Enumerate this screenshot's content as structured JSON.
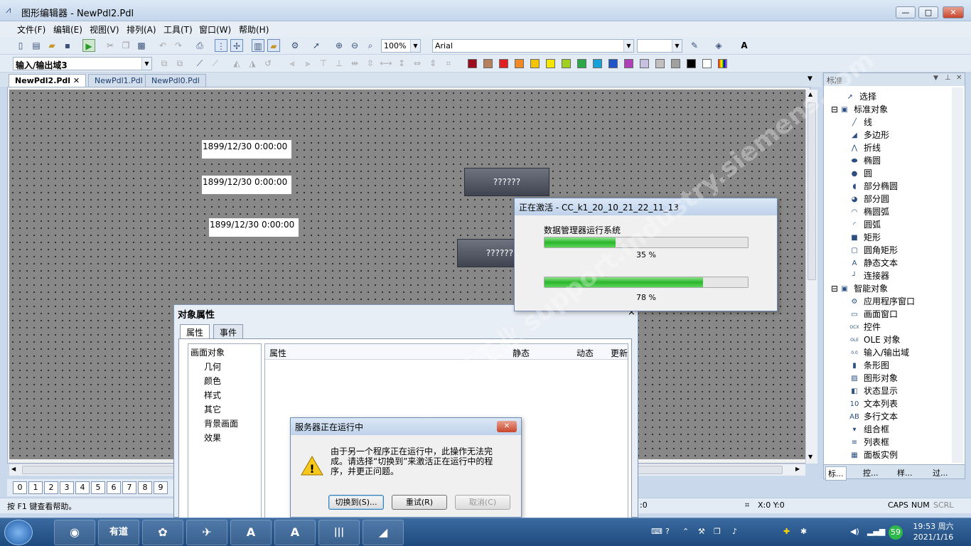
{
  "window": {
    "title": "图形编辑器 - NewPdl2.Pdl",
    "min": "—",
    "max": "□",
    "close": "✕"
  },
  "menu": [
    "文件(F)",
    "编辑(E)",
    "视图(V)",
    "排列(A)",
    "工具(T)",
    "窗口(W)",
    "帮助(H)"
  ],
  "toolbar1": {
    "zoom": "100%",
    "font": "Arial"
  },
  "toolbar2": {
    "object_select": "输入/输出域3"
  },
  "palette": [
    "#9b0e1e",
    "#b8815e",
    "#e02020",
    "#f08a24",
    "#f4c400",
    "#f4e600",
    "#a0d020",
    "#2aa84a",
    "#18a0d8",
    "#2255c8",
    "#b040b8",
    "#c8c0e0",
    "#c0c0c0",
    "#a0a0a0",
    "#000000",
    "#ffffff"
  ],
  "tabs": [
    "NewPdl2.Pdl",
    "NewPdl1.Pdl",
    "NewPdl0.Pdl"
  ],
  "canvas": {
    "dates": [
      "1899/12/30 0:00:00",
      "1899/12/30 0:00:00",
      "1899/12/30 0:00:00"
    ],
    "qbuttons": [
      "??????",
      "??????"
    ]
  },
  "pages": [
    "0",
    "1",
    "2",
    "3",
    "4",
    "5",
    "6",
    "7",
    "8",
    "9"
  ],
  "status": {
    "help": "按 F1 键查看帮助。",
    "coord1": "X:0 Y:0",
    "coord0": ":0",
    "caps": "CAPS",
    "num": "NUM",
    "scrl": "SCRL"
  },
  "panel": {
    "title": "标准",
    "items": [
      {
        "label": "选择",
        "icon": "cursor-icon",
        "glyph": "➚"
      },
      {
        "label": "标准对象",
        "icon": "folder-icon",
        "glyph": "▣"
      },
      {
        "label": "线",
        "icon": "line-icon",
        "glyph": "╱"
      },
      {
        "label": "多边形",
        "icon": "polygon-icon",
        "glyph": "◢"
      },
      {
        "label": "折线",
        "icon": "polyline-icon",
        "glyph": "⋀"
      },
      {
        "label": "椭圆",
        "icon": "ellipse-icon",
        "glyph": "⬬"
      },
      {
        "label": "圆",
        "icon": "circle-icon",
        "glyph": "●"
      },
      {
        "label": "部分椭圆",
        "icon": "partial-ellipse-icon",
        "glyph": "◖"
      },
      {
        "label": "部分圆",
        "icon": "partial-circle-icon",
        "glyph": "◕"
      },
      {
        "label": "椭圆弧",
        "icon": "ellipse-arc-icon",
        "glyph": "◠"
      },
      {
        "label": "圆弧",
        "icon": "arc-icon",
        "glyph": "◜"
      },
      {
        "label": "矩形",
        "icon": "rectangle-icon",
        "glyph": "■"
      },
      {
        "label": "圆角矩形",
        "icon": "rounded-rect-icon",
        "glyph": "▢"
      },
      {
        "label": "静态文本",
        "icon": "text-icon",
        "glyph": "A"
      },
      {
        "label": "连接器",
        "icon": "connector-icon",
        "glyph": "┘"
      },
      {
        "label": "智能对象",
        "icon": "folder-icon",
        "glyph": "▣"
      },
      {
        "label": "应用程序窗口",
        "icon": "app-window-icon",
        "glyph": "⚙"
      },
      {
        "label": "画面窗口",
        "icon": "picture-window-icon",
        "glyph": "▭"
      },
      {
        "label": "控件",
        "icon": "control-icon",
        "glyph": "OCX"
      },
      {
        "label": "OLE 对象",
        "icon": "ole-icon",
        "glyph": "OLE"
      },
      {
        "label": "输入/输出域",
        "icon": "io-field-icon",
        "glyph": "0.0"
      },
      {
        "label": "条形图",
        "icon": "bar-icon",
        "glyph": "▮"
      },
      {
        "label": "图形对象",
        "icon": "graphic-icon",
        "glyph": "▨"
      },
      {
        "label": "状态显示",
        "icon": "status-icon",
        "glyph": "◧"
      },
      {
        "label": "文本列表",
        "icon": "textlist-icon",
        "glyph": "10"
      },
      {
        "label": "多行文本",
        "icon": "multiline-icon",
        "glyph": "AB"
      },
      {
        "label": "组合框",
        "icon": "combobox-icon",
        "glyph": "▾"
      },
      {
        "label": "列表框",
        "icon": "listbox-icon",
        "glyph": "≡"
      },
      {
        "label": "面板实例",
        "icon": "panel-icon",
        "glyph": "▦"
      }
    ],
    "tabs": [
      "标...",
      "控...",
      "样...",
      "过..."
    ]
  },
  "props": {
    "title": "对象属性",
    "tabs": [
      "属性",
      "事件"
    ],
    "tree": [
      "画面对象",
      "几何",
      "颜色",
      "样式",
      "其它",
      "背景画面",
      "效果"
    ],
    "columns": [
      "属性",
      "静态",
      "动态",
      "更新"
    ],
    "close": "×"
  },
  "activate": {
    "title": "正在激活 - CC_k1_20_10_21_22_11_13",
    "label": "数据管理器运行系统",
    "progress1": 35,
    "progress1_text": "35 %",
    "progress2": 78,
    "progress2_text": "78 %"
  },
  "warn": {
    "title": "服务器正在运行中",
    "message": "由于另一个程序正在运行中，此操作无法完成。请选择“切换到”来激活正在运行中的程序，并更正问题。",
    "buttons": [
      "切换到(S)...",
      "重试(R)",
      "取消(C)"
    ],
    "close": "✕"
  },
  "taskbar": {
    "apps": [
      "◉",
      "有道",
      "✿",
      "✈",
      "A",
      "A",
      "|||",
      "◢"
    ],
    "time": "19:53 周六",
    "date": "2021/1/16",
    "badge": "59"
  },
  "watermark": "西门子工业 support.industry.siemens.com"
}
